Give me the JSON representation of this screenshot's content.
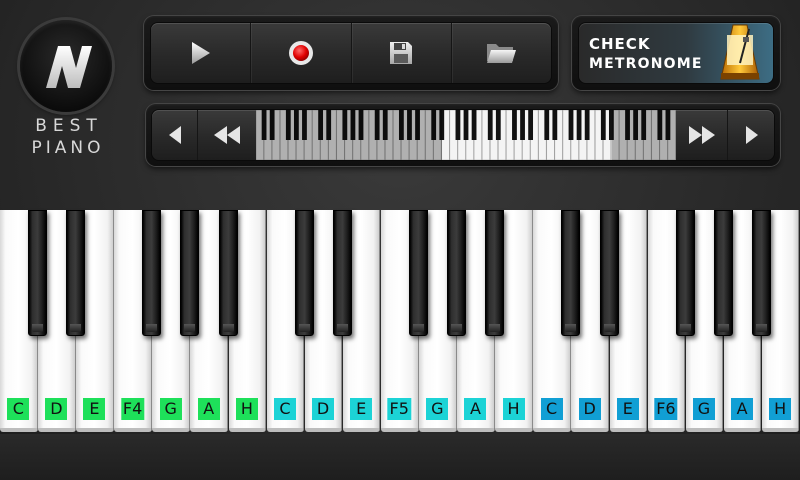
{
  "logo": {
    "line1": "BEST",
    "line2": "PIANO",
    "icon": "n-logo-icon"
  },
  "transport": [
    {
      "name": "play-button",
      "icon": "play-icon"
    },
    {
      "name": "record-button",
      "icon": "record-icon"
    },
    {
      "name": "save-button",
      "icon": "floppy-disk-icon"
    },
    {
      "name": "open-button",
      "icon": "folder-icon"
    }
  ],
  "metronome": {
    "line1": "CHECK",
    "line2": "METRONOME",
    "icon": "metronome-icon"
  },
  "navigation": {
    "prev": "left-arrow-icon",
    "rewind": "double-left-arrow-icon",
    "forward": "double-right-arrow-icon",
    "next": "right-arrow-icon"
  },
  "colors": {
    "octave1_label": "#1ee05a",
    "octave2_label": "#1cd3d6",
    "octave3_label": "#119fd4"
  },
  "keys": [
    {
      "label": "C",
      "octave": 1
    },
    {
      "label": "D",
      "octave": 1
    },
    {
      "label": "E",
      "octave": 1
    },
    {
      "label": "F4",
      "octave": 1
    },
    {
      "label": "G",
      "octave": 1
    },
    {
      "label": "A",
      "octave": 1
    },
    {
      "label": "H",
      "octave": 1
    },
    {
      "label": "C",
      "octave": 2
    },
    {
      "label": "D",
      "octave": 2
    },
    {
      "label": "E",
      "octave": 2
    },
    {
      "label": "F5",
      "octave": 2
    },
    {
      "label": "G",
      "octave": 2
    },
    {
      "label": "A",
      "octave": 2
    },
    {
      "label": "H",
      "octave": 2
    },
    {
      "label": "C",
      "octave": 3
    },
    {
      "label": "D",
      "octave": 3
    },
    {
      "label": "E",
      "octave": 3
    },
    {
      "label": "F6",
      "octave": 3
    },
    {
      "label": "G",
      "octave": 3
    },
    {
      "label": "A",
      "octave": 3
    },
    {
      "label": "H",
      "octave": 3
    }
  ]
}
